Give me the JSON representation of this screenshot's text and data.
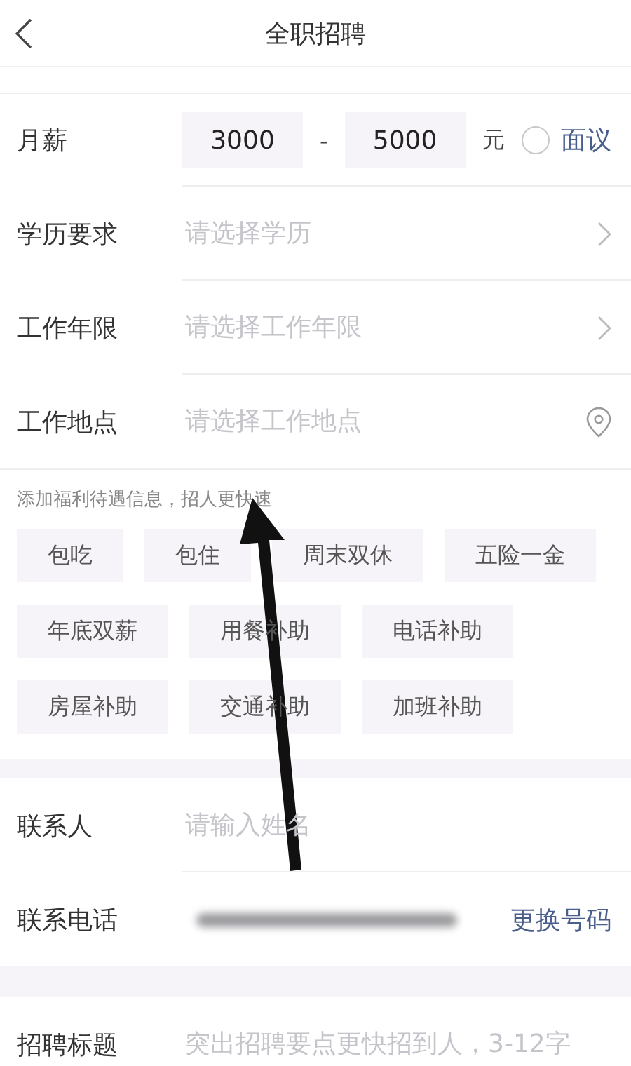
{
  "header": {
    "title": "全职招聘"
  },
  "salary": {
    "label": "月薪",
    "min": "3000",
    "separator": "-",
    "max": "5000",
    "unit": "元",
    "negotiable": {
      "label": "面议",
      "checked": false
    }
  },
  "fields": [
    {
      "kind": "select",
      "label": "学历要求",
      "placeholder": "请选择学历"
    },
    {
      "kind": "select",
      "label": "工作年限",
      "placeholder": "请选择工作年限"
    },
    {
      "kind": "location",
      "label": "工作地点",
      "placeholder": "请选择工作地点"
    }
  ],
  "benefits": {
    "hint": "添加福利待遇信息，招人更快速",
    "tags": [
      {
        "label": "包吃",
        "selected": false
      },
      {
        "label": "包住",
        "selected": false
      },
      {
        "label": "周末双休",
        "selected": false
      },
      {
        "label": "五险一金",
        "selected": false
      },
      {
        "label": "年底双薪",
        "selected": false
      },
      {
        "label": "用餐补助",
        "selected": false
      },
      {
        "label": "电话补助",
        "selected": false
      },
      {
        "label": "房屋补助",
        "selected": false
      },
      {
        "label": "交通补助",
        "selected": false
      },
      {
        "label": "加班补助",
        "selected": false
      }
    ]
  },
  "contact": [
    {
      "kind": "text",
      "label": "联系人",
      "placeholder": "请输入姓名"
    },
    {
      "kind": "phone",
      "label": "联系电话",
      "action": "更换号码"
    }
  ],
  "job_title": {
    "label": "招聘标题",
    "placeholder": "突出招聘要点更快招到人，3-12字"
  }
}
